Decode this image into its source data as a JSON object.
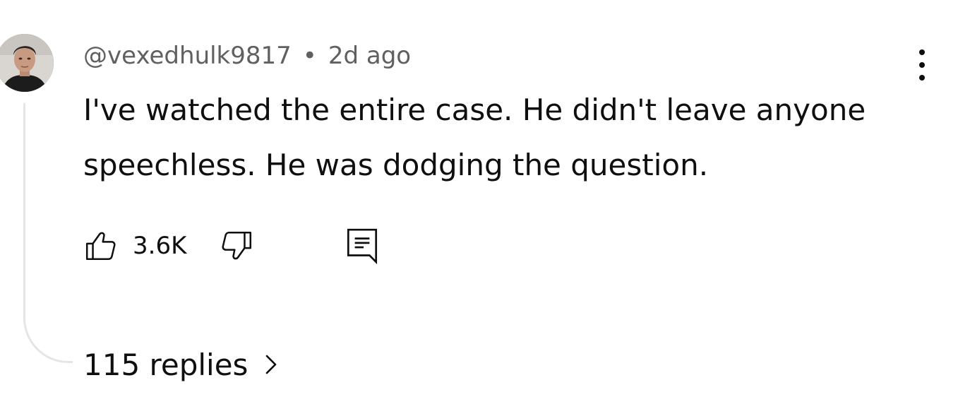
{
  "comment": {
    "author": "@vexedhulk9817",
    "separator": "•",
    "time": "2d ago",
    "text": "I've watched the entire case. He didn't leave anyone speechless. He was dodging the question.",
    "likes": "3.6K",
    "replies_label": "115 replies"
  },
  "icons": {
    "avatar": "user-avatar",
    "more": "more-vertical-icon",
    "like": "thumbs-up-icon",
    "dislike": "thumbs-down-icon",
    "reply": "reply-comment-icon",
    "chevron": "chevron-right-icon"
  },
  "colors": {
    "text_primary": "#0f0f0f",
    "text_secondary": "#606060",
    "thread_line": "#e5e5e5"
  }
}
